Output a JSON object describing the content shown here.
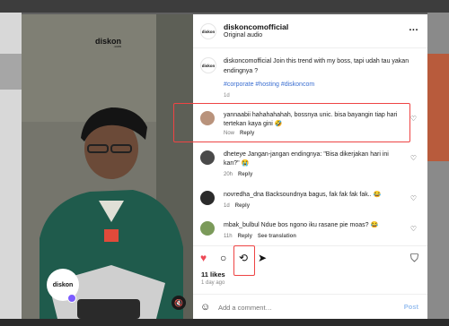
{
  "media": {
    "brand_text": "diskon",
    "brand_sub": ".com",
    "badge_text": "diskon",
    "mute_icon": "speaker-mute-icon"
  },
  "header": {
    "avatar_text": "diskon",
    "username": "diskoncomofficial",
    "audio": "Original audio",
    "more_icon": "..."
  },
  "caption": {
    "avatar_text": "diskon",
    "text": "diskoncomofficial Join this trend with my boss, tapi udah tau yakan endingnya ?",
    "tags": "#corporate #hosting #diskoncom",
    "time": "1d"
  },
  "comments": [
    {
      "text": "yannaabii hahahahahah, bossnya unic. bisa bayangin tiap hari tertekan kaya gini 🤣",
      "time": "Now",
      "reply": "Reply",
      "avatar_color": "#b9937c",
      "translation": ""
    },
    {
      "text": "dheteye Jangan-jangan endingnya: \"Bisa dikerjakan hari ini kan?\" 😭",
      "time": "20h",
      "reply": "Reply",
      "avatar_color": "#4a4a4a",
      "translation": ""
    },
    {
      "text": "novredha_dna Backsoundnya bagus, fak fak fak fak.. 😂",
      "time": "1d",
      "reply": "Reply",
      "avatar_color": "#2b2b2b",
      "translation": ""
    },
    {
      "text": "mbak_bulbul Ndue bos ngono iku rasane pie moas? 😂",
      "time": "11h",
      "reply": "Reply",
      "avatar_color": "#7b9a5a",
      "translation": "See translation"
    }
  ],
  "actions": {
    "like": "♥",
    "comment": "○",
    "repost": "⟲",
    "share": "➤",
    "save": "⛉"
  },
  "likes": "11 likes",
  "posted": "1 day ago",
  "add_comment": {
    "placeholder": "Add a comment…",
    "post": "Post"
  },
  "colors": {
    "like": "#ed4956",
    "link": "#3a6ed1",
    "highlight": "#ee4444"
  }
}
